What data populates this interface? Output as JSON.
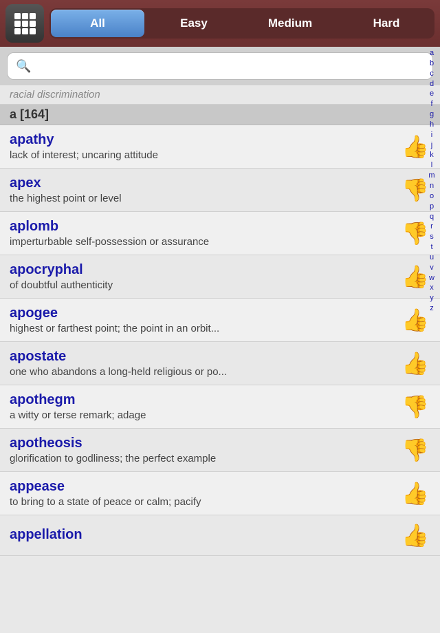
{
  "header": {
    "tabs": [
      {
        "label": "All",
        "active": true
      },
      {
        "label": "Easy",
        "active": false
      },
      {
        "label": "Medium",
        "active": false
      },
      {
        "label": "Hard",
        "active": false
      }
    ]
  },
  "search": {
    "placeholder": "",
    "value": ""
  },
  "section": {
    "label": "a [164]"
  },
  "ghost_row": {
    "text": "racial discrimination"
  },
  "words": [
    {
      "word": "apathy",
      "definition": "lack of interest; uncaring attitude",
      "thumb": "👍",
      "thumb_type": "up"
    },
    {
      "word": "apex",
      "definition": "the highest point or level",
      "thumb": "👎",
      "thumb_type": "down"
    },
    {
      "word": "aplomb",
      "definition": "imperturbable self-possession or assurance",
      "thumb": "👎",
      "thumb_type": "down"
    },
    {
      "word": "apocryphal",
      "definition": "of doubtful authenticity",
      "thumb": "👍",
      "thumb_type": "up"
    },
    {
      "word": "apogee",
      "definition": "highest or farthest point; the point in an orbit...",
      "thumb": "👍",
      "thumb_type": "up"
    },
    {
      "word": "apostate",
      "definition": "one who abandons a long-held religious or po...",
      "thumb": "👍",
      "thumb_type": "up"
    },
    {
      "word": "apothegm",
      "definition": "a witty or terse remark; adage",
      "thumb": "👎",
      "thumb_type": "down"
    },
    {
      "word": "apotheosis",
      "definition": "glorification to godliness; the perfect example",
      "thumb": "👎",
      "thumb_type": "down"
    },
    {
      "word": "appease",
      "definition": "to bring to a state of peace or calm; pacify",
      "thumb": "👍",
      "thumb_type": "up"
    },
    {
      "word": "appellation",
      "definition": "",
      "thumb": "👍",
      "thumb_type": "up"
    }
  ],
  "alphabet": [
    "a",
    "b",
    "c",
    "d",
    "e",
    "f",
    "g",
    "h",
    "i",
    "j",
    "k",
    "l",
    "m",
    "n",
    "o",
    "p",
    "q",
    "r",
    "s",
    "t",
    "u",
    "v",
    "w",
    "x",
    "y",
    "z"
  ]
}
